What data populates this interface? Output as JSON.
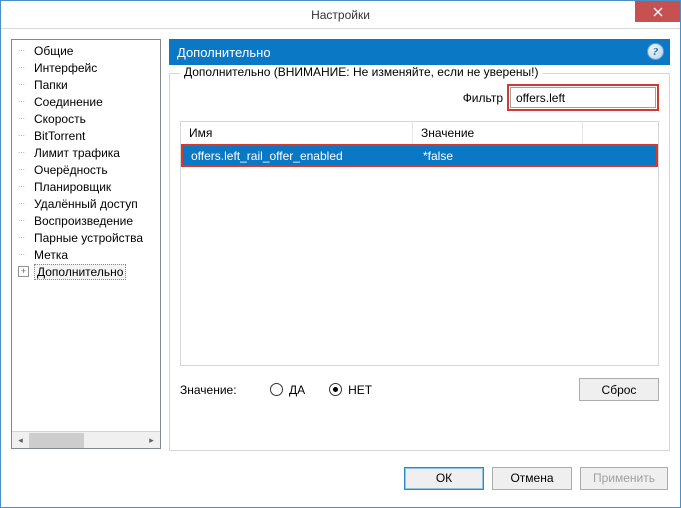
{
  "window": {
    "title": "Настройки"
  },
  "sidebar": {
    "items": [
      {
        "label": "Общие"
      },
      {
        "label": "Интерфейс"
      },
      {
        "label": "Папки"
      },
      {
        "label": "Соединение"
      },
      {
        "label": "Скорость"
      },
      {
        "label": "BitTorrent"
      },
      {
        "label": "Лимит трафика"
      },
      {
        "label": "Очерёдность"
      },
      {
        "label": "Планировщик"
      },
      {
        "label": "Удалённый доступ"
      },
      {
        "label": "Воспроизведение"
      },
      {
        "label": "Парные устройства"
      },
      {
        "label": "Метка"
      },
      {
        "label": "Дополнительно",
        "expandable": true,
        "selected": true
      }
    ]
  },
  "panel": {
    "title": "Дополнительно",
    "legend": "Дополнительно (ВНИМАНИЕ: Не изменяйте, если не уверены!)",
    "filter_label": "Фильтр",
    "filter_value": "offers.left",
    "columns": {
      "name": "Имя",
      "value": "Значение"
    },
    "rows": [
      {
        "name": "offers.left_rail_offer_enabled",
        "value": "*false",
        "selected": true
      }
    ],
    "value_label": "Значение:",
    "radio_yes": "ДА",
    "radio_no": "НЕТ",
    "radio_selected": "no",
    "reset": "Сброс"
  },
  "footer": {
    "ok": "ОК",
    "cancel": "Отмена",
    "apply": "Применить"
  }
}
